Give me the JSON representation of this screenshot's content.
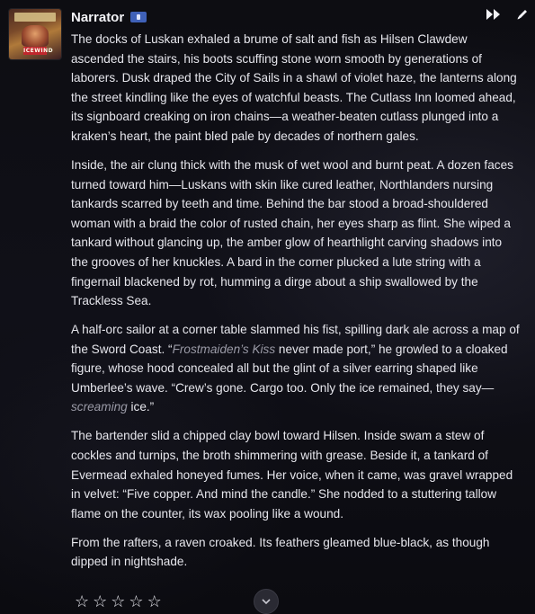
{
  "message": {
    "author": "Narrator",
    "avatar_banner_text": "ICEWIND",
    "badge_icon": "narrator-badge-icon",
    "toolbar": {
      "fast_forward_icon": "fast-forward-icon",
      "edit_icon": "pencil-icon"
    },
    "paragraphs": [
      {
        "parts": [
          {
            "t": "The docks of Luskan exhaled a brume of salt and fish as Hilsen Clawdew ascended the stairs, his boots scuffing stone worn smooth by generations of laborers. Dusk draped the City of Sails in a shawl of violet haze, the lanterns along the street kindling like the eyes of watchful beasts. The Cutlass Inn loomed ahead, its signboard creaking on iron chains—a weather-beaten cutlass plunged into a kraken’s heart, the paint bled pale by decades of northern gales."
          }
        ]
      },
      {
        "parts": [
          {
            "t": "Inside, the air clung thick with the musk of wet wool and burnt peat. A dozen faces turned toward him—Luskans with skin like cured leather, Northlanders nursing tankards scarred by teeth and time. Behind the bar stood a broad-shouldered woman with a braid the color of rusted chain, her eyes sharp as flint. She wiped a tankard without glancing up, the amber glow of hearthlight carving shadows into the grooves of her knuckles. A bard in the corner plucked a lute string with a fingernail blackened by rot, humming a dirge about a ship swallowed by the Trackless Sea."
          }
        ]
      },
      {
        "parts": [
          {
            "t": "A half-orc sailor at a corner table slammed his fist, spilling dark ale across a map of the Sword Coast. “"
          },
          {
            "t": "Frostmaiden’s Kiss",
            "em": true
          },
          {
            "t": " never made port,” he growled to a cloaked figure, whose hood concealed all but the glint of a silver earring shaped like Umberlee’s wave. “Crew’s gone. Cargo too. Only the ice remained, they say—"
          },
          {
            "t": "screaming",
            "em": true
          },
          {
            "t": " ice.”"
          }
        ]
      },
      {
        "parts": [
          {
            "t": "The bartender slid a chipped clay bowl toward Hilsen. Inside swam a stew of cockles and turnips, the broth shimmering with grease. Beside it, a tankard of Evermead exhaled honeyed fumes. Her voice, when it came, was gravel wrapped in velvet: “Five copper. And mind the candle.” She nodded to a stuttering tallow flame on the counter, its wax pooling like a wound."
          }
        ]
      },
      {
        "parts": [
          {
            "t": "From the rafters, a raven croaked. Its feathers gleamed blue-black, as though dipped in nightshade."
          }
        ]
      }
    ],
    "rating": {
      "stars_total": 5,
      "stars_filled": 0,
      "star_glyph": "☆"
    },
    "scroll_icon": "chevron-down-icon"
  }
}
